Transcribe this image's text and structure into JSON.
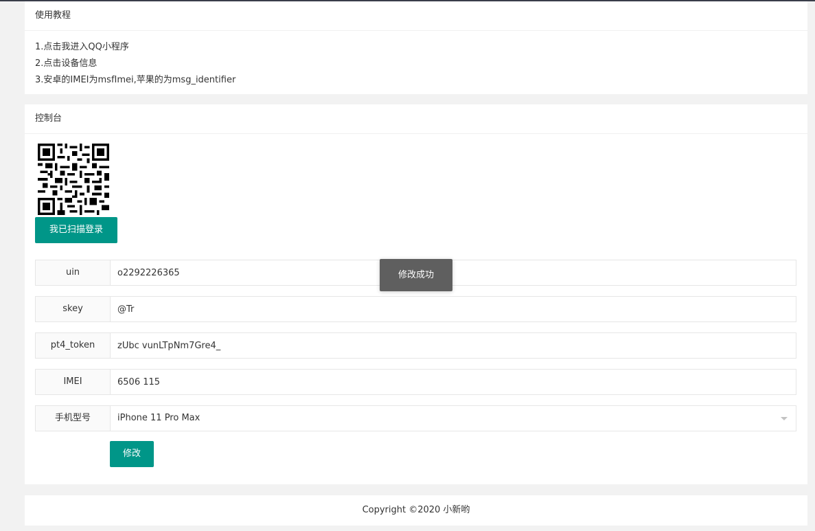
{
  "tutorial": {
    "title": "使用教程",
    "steps": [
      "1.点击我进入QQ小程序",
      "2.点击设备信息",
      "3.安卓的IMEI为msfImei,苹果的为msg_identifier"
    ]
  },
  "console": {
    "title": "控制台",
    "scan_button": "我已扫描登录",
    "fields": {
      "uin": {
        "label": "uin",
        "value": "o2292226365"
      },
      "skey": {
        "label": "skey",
        "value": "@Tr"
      },
      "pt4_token": {
        "label": "pt4_token",
        "value": "zUbc vunLTpNm7Gre4_"
      },
      "imei": {
        "label": "IMEI",
        "value": "6506 115"
      },
      "model": {
        "label": "手机型号",
        "value": "iPhone 11 Pro Max"
      }
    },
    "submit_button": "修改"
  },
  "toast": {
    "message": "修改成功"
  },
  "footer": {
    "copyright": "Copyright ©2020 小新哟"
  },
  "colors": {
    "accent": "#009688",
    "toast_bg": "#5f5f5f",
    "page_bg": "#f2f2f2"
  }
}
